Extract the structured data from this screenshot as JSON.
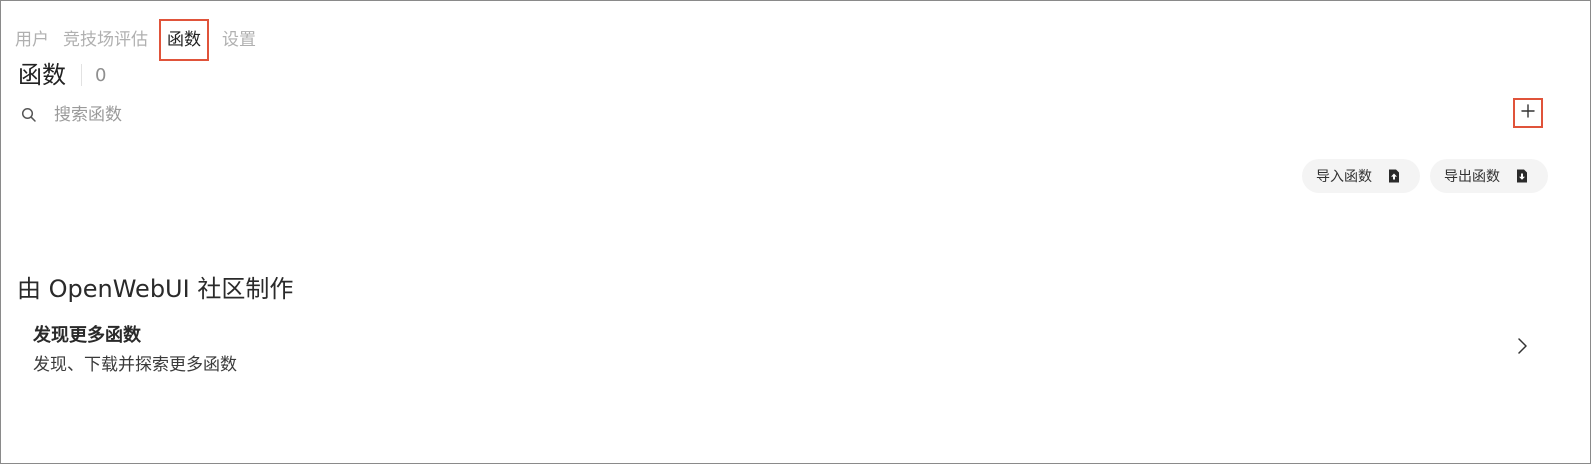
{
  "tabs": [
    {
      "label": "用户"
    },
    {
      "label": "竞技场评估"
    },
    {
      "label": "函数"
    },
    {
      "label": "设置"
    }
  ],
  "header": {
    "title": "函数",
    "count": "0"
  },
  "search": {
    "placeholder": "搜索函数",
    "value": "",
    "icon": "search-icon"
  },
  "toolbar": {
    "add_icon": "plus-icon",
    "import_label": "导入函数",
    "export_label": "导出函数",
    "import_icon": "file-upload-icon",
    "export_icon": "file-download-icon"
  },
  "community": {
    "title": "由 OpenWebUI 社区制作",
    "card_title": "发现更多函数",
    "card_subtitle": "发现、下载并探索更多函数",
    "chevron_icon": "chevron-right-icon"
  },
  "colors": {
    "highlight": "#e0533a",
    "muted_tab": "#b0b0b0"
  }
}
